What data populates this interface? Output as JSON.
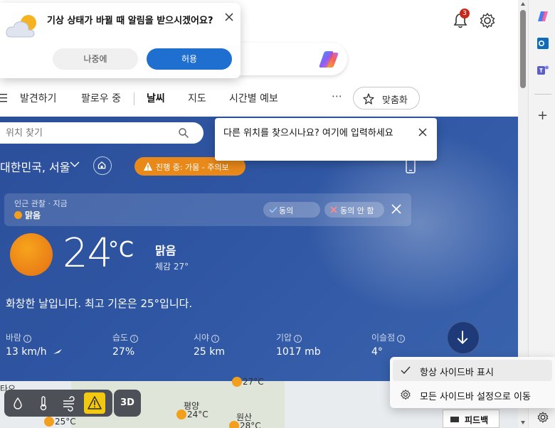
{
  "notification": {
    "message": "기상 상태가 바뀔 때 알림을 받으시겠어요?",
    "later_label": "나중에",
    "allow_label": "허용"
  },
  "topbar": {
    "notification_count": "3"
  },
  "nav": {
    "items": [
      "발견하기",
      "팔로우 중",
      "날씨",
      "지도",
      "시간별 예보"
    ],
    "more": "⋯",
    "customize_label": "맞춤화"
  },
  "weather": {
    "search_placeholder": "위치 찾기",
    "location": "대한민국, 서울",
    "alert": "진행 중: 가뭄 - 주의보",
    "observation_label": "인근 관찰 · 지금",
    "observation_condition": "맑음",
    "agree_label": "동의",
    "disagree_label": "동의 안 함",
    "temperature": "24",
    "unit": "°C",
    "condition": "맑음",
    "feels_like": "체감  27°",
    "summary": "화창한 날입니다. 최고 기온은 25°입니다.",
    "stats": [
      {
        "label": "바람",
        "value": "13 km/h"
      },
      {
        "label": "습도",
        "value": "27%"
      },
      {
        "label": "시야",
        "value": "25 km"
      },
      {
        "label": "기압",
        "value": "1017 mb"
      },
      {
        "label": "이슬점",
        "value": "4°"
      }
    ]
  },
  "tooltip": {
    "text": "다른 위치를 찾으시나요? 여기에 입력하세요"
  },
  "map": {
    "button_3d": "3D",
    "cities": [
      {
        "name": "",
        "temp": "27°C"
      },
      {
        "name": "평양",
        "temp": "24°C"
      },
      {
        "name": "원산",
        "temp": "28°C"
      },
      {
        "name": "",
        "temp": "25°C"
      }
    ],
    "left_edge_label": "타오",
    "feedback_label": "피드백"
  },
  "context_menu": {
    "items": [
      "항상 사이드바 표시",
      "모든 사이드바 설정으로 이동"
    ]
  },
  "colors": {
    "weather_bg": "#2f56a3",
    "alert_orange": "#e8891a",
    "allow_blue": "#1f6fd1",
    "badge_red": "#c42b1c"
  }
}
